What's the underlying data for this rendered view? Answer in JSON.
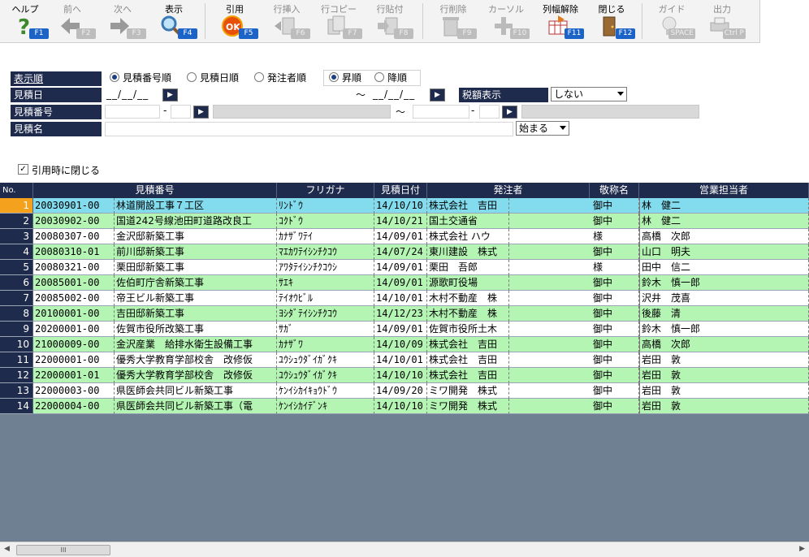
{
  "toolbar": {
    "buttons": [
      {
        "label": "ヘルプ",
        "key": "F1",
        "icon": "help-icon",
        "enabled": true
      },
      {
        "label": "前へ",
        "key": "F2",
        "icon": "arrow-left-icon",
        "enabled": false
      },
      {
        "label": "次へ",
        "key": "F3",
        "icon": "arrow-right-icon",
        "enabled": false
      },
      {
        "label": "表示",
        "key": "F4",
        "icon": "magnifier-icon",
        "enabled": true
      },
      {
        "label": "引用",
        "key": "F5",
        "icon": "ok-icon",
        "enabled": true
      },
      {
        "label": "行挿入",
        "key": "F6",
        "icon": "row-insert-icon",
        "enabled": false
      },
      {
        "label": "行コピー",
        "key": "F7",
        "icon": "row-copy-icon",
        "enabled": false
      },
      {
        "label": "行貼付",
        "key": "F8",
        "icon": "row-paste-icon",
        "enabled": false
      },
      {
        "label": "行削除",
        "key": "F9",
        "icon": "row-delete-icon",
        "enabled": false
      },
      {
        "label": "カーソル",
        "key": "F10",
        "icon": "cursor-cross-icon",
        "enabled": false
      },
      {
        "label": "列幅解除",
        "key": "F11",
        "icon": "column-width-icon",
        "enabled": true
      },
      {
        "label": "閉じる",
        "key": "F12",
        "icon": "door-exit-icon",
        "enabled": true
      },
      {
        "label": "ガイド",
        "key": "SPACE",
        "icon": "lightbulb-icon",
        "enabled": false
      },
      {
        "label": "出力",
        "key": "Ctrl P",
        "icon": "print-icon",
        "enabled": false
      }
    ]
  },
  "form": {
    "order_label": "表示順",
    "order_options": [
      "見積番号順",
      "見積日順",
      "発注者順"
    ],
    "order_selected": "見積番号順",
    "direction_options": [
      "昇順",
      "降順"
    ],
    "direction_selected": "昇順",
    "date_label": "見積日",
    "date_from": "__/__/__",
    "date_to": "__/__/__",
    "tilde": "～",
    "number_label": "見積番号",
    "dash": "-",
    "tax_label": "税額表示",
    "tax_value": "しない",
    "name_label": "見積名",
    "match_value": "始まる",
    "close_on_quote_label": "引用時に閉じる",
    "close_on_quote_checked": true
  },
  "grid": {
    "columns": [
      "No.",
      "見積番号",
      "フリガナ",
      "見積日付",
      "発注者",
      "敬称名",
      "営業担当者"
    ],
    "selected_row": 1,
    "rows": [
      {
        "no": "1",
        "number": "20030901-00",
        "name": "林道開設工事７工区",
        "kana": "ﾘﾝﾄﾞｳ",
        "date": "14/10/10",
        "client": "株式会社　吉田",
        "honorific": "御中",
        "staff": "林　健二"
      },
      {
        "no": "2",
        "number": "20030902-00",
        "name": "国道242号線池田町道路改良工",
        "kana": "ｺｸﾄﾞｳ",
        "date": "14/10/21",
        "client": "国土交通省",
        "honorific": "御中",
        "staff": "林　健二"
      },
      {
        "no": "3",
        "number": "20080307-00",
        "name": "金沢邸新築工事",
        "kana": "ｶﾅｻﾞﾜﾃｲ",
        "date": "14/09/01",
        "client": "株式会社 ハウ",
        "honorific": "様",
        "staff": "高橋　次郎"
      },
      {
        "no": "4",
        "number": "20080310-01",
        "name": "前川邸新築工事",
        "kana": "ﾏｴｶﾜﾃｲｼﾝﾁｸｺｳ",
        "date": "14/07/24",
        "client": "東川建設　株式",
        "honorific": "御中",
        "staff": "山口　明夫"
      },
      {
        "no": "5",
        "number": "20080321-00",
        "name": "栗田邸新築工事",
        "kana": "ｱﾜﾀﾃｲｼﾝﾁｸｺｳｼ",
        "date": "14/09/01",
        "client": "栗田　吾郎",
        "honorific": "様",
        "staff": "田中　信二"
      },
      {
        "no": "6",
        "number": "20085001-00",
        "name": "佐伯町庁舎新築工事",
        "kana": "ｻｴｷ",
        "date": "14/09/01",
        "client": "源歌町役場",
        "honorific": "御中",
        "staff": "鈴木　慎一郎"
      },
      {
        "no": "7",
        "number": "20085002-00",
        "name": "帝王ビル新築工事",
        "kana": "ﾃｲｵｳﾋﾞﾙ",
        "date": "14/10/01",
        "client": "木村不動産　株",
        "honorific": "御中",
        "staff": "沢井　茂喜"
      },
      {
        "no": "8",
        "number": "20100001-00",
        "name": "吉田邸新築工事",
        "kana": "ﾖｼﾀﾞﾃｲｼﾝﾁｸｺｳ",
        "date": "14/12/23",
        "client": "木村不動産　株",
        "honorific": "御中",
        "staff": "後藤　清"
      },
      {
        "no": "9",
        "number": "20200001-00",
        "name": "佐賀市役所改築工事",
        "kana": "ｻｶﾞ",
        "date": "14/09/01",
        "client": "佐賀市役所土木",
        "honorific": "御中",
        "staff": "鈴木　慎一郎"
      },
      {
        "no": "10",
        "number": "21000009-00",
        "name": "金沢産業　給排水衛生設備工事",
        "kana": "ｶﾅｻﾞﾜ",
        "date": "14/10/09",
        "client": "株式会社　吉田",
        "honorific": "御中",
        "staff": "高橋　次郎"
      },
      {
        "no": "11",
        "number": "22000001-00",
        "name": "優秀大学教育学部校舎　改修仮",
        "kana": "ﾕｳｼｭｳﾀﾞｲｶﾞｸｷ",
        "date": "14/10/01",
        "client": "株式会社　吉田",
        "honorific": "御中",
        "staff": "岩田　敦"
      },
      {
        "no": "12",
        "number": "22000001-01",
        "name": "優秀大学教育学部校舎　改修仮",
        "kana": "ﾕｳｼｭｳﾀﾞｲｶﾞｸｷ",
        "date": "14/10/10",
        "client": "株式会社　吉田",
        "honorific": "御中",
        "staff": "岩田　敦"
      },
      {
        "no": "13",
        "number": "22000003-00",
        "name": "県医師会共同ビル新築工事",
        "kana": "ｹﾝｲｼｶｲｷｮｳﾄﾞｳ",
        "date": "14/09/20",
        "client": "ミワ開発　株式",
        "honorific": "御中",
        "staff": "岩田　敦"
      },
      {
        "no": "14",
        "number": "22000004-00",
        "name": "県医師会共同ビル新築工事（電",
        "kana": "ｹﾝｲｼｶｲﾃﾞﾝｷ",
        "date": "14/10/10",
        "client": "ミワ開発　株式",
        "honorific": "御中",
        "staff": "岩田　敦"
      }
    ]
  },
  "colors": {
    "row_green": "#b4f5b4",
    "row_white": "#ffffff",
    "row_selected": "#82dcee",
    "header": "#1f2b4d",
    "grid_bg": "#6f8092",
    "key_badge": "#1c63c7"
  },
  "scrollbar": {
    "thumb_label": "III"
  }
}
